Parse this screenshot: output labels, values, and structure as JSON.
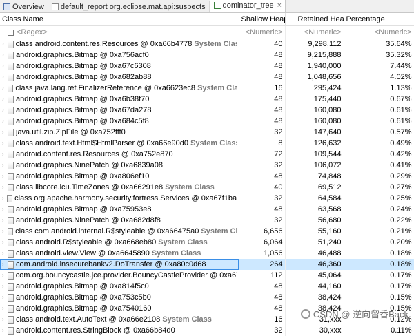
{
  "tabs": [
    {
      "label": "Overview",
      "icon": "overview-icon"
    },
    {
      "label": "default_report  org.eclipse.mat.api:suspects",
      "icon": "report-icon"
    },
    {
      "label": "dominator_tree",
      "icon": "tree-icon",
      "close": "×"
    }
  ],
  "columns": {
    "name": "Class Name",
    "shallow": "Shallow Heap",
    "retained": "Retained Heap",
    "percentage": "Percentage"
  },
  "filter": {
    "name": "<Regex>",
    "shallow": "<Numeric>",
    "retained": "<Numeric>",
    "percentage": "<Numeric>"
  },
  "rows": [
    {
      "name": "class android.content.res.Resources @ 0xa66b4778",
      "suffix": " System Class",
      "shallow": "40",
      "retained": "9,298,112",
      "percentage": "35.64%"
    },
    {
      "name": "android.graphics.Bitmap @ 0xa756acf0",
      "suffix": "",
      "shallow": "48",
      "retained": "9,215,888",
      "percentage": "35.32%"
    },
    {
      "name": "android.graphics.Bitmap @ 0xa67c6308",
      "suffix": "",
      "shallow": "48",
      "retained": "1,940,000",
      "percentage": "7.44%"
    },
    {
      "name": "android.graphics.Bitmap @ 0xa682ab88",
      "suffix": "",
      "shallow": "48",
      "retained": "1,048,656",
      "percentage": "4.02%"
    },
    {
      "name": "class java.lang.ref.FinalizerReference @ 0xa6623ec8",
      "suffix": " System Class",
      "shallow": "16",
      "retained": "295,424",
      "percentage": "1.13%"
    },
    {
      "name": "android.graphics.Bitmap @ 0xa6b38f70",
      "suffix": "",
      "shallow": "48",
      "retained": "175,440",
      "percentage": "0.67%"
    },
    {
      "name": "android.graphics.Bitmap @ 0xa67da278",
      "suffix": "",
      "shallow": "48",
      "retained": "160,080",
      "percentage": "0.61%"
    },
    {
      "name": "android.graphics.Bitmap @ 0xa684c5f8",
      "suffix": "",
      "shallow": "48",
      "retained": "160,080",
      "percentage": "0.61%"
    },
    {
      "name": "java.util.zip.ZipFile @ 0xa752fff0",
      "suffix": "",
      "shallow": "32",
      "retained": "147,640",
      "percentage": "0.57%"
    },
    {
      "name": "class android.text.Html$HtmlParser @ 0xa66e90d0",
      "suffix": " System Class",
      "shallow": "8",
      "retained": "126,632",
      "percentage": "0.49%"
    },
    {
      "name": "android.content.res.Resources @ 0xa752e870",
      "suffix": "",
      "shallow": "72",
      "retained": "109,544",
      "percentage": "0.42%"
    },
    {
      "name": "android.graphics.NinePatch @ 0xa6839a08",
      "suffix": "",
      "shallow": "32",
      "retained": "106,072",
      "percentage": "0.41%"
    },
    {
      "name": "android.graphics.Bitmap @ 0xa806ef10",
      "suffix": "",
      "shallow": "48",
      "retained": "74,848",
      "percentage": "0.29%"
    },
    {
      "name": "class libcore.icu.TimeZones @ 0xa66291e8",
      "suffix": " System Class",
      "shallow": "40",
      "retained": "69,512",
      "percentage": "0.27%"
    },
    {
      "name": "class org.apache.harmony.security.fortress.Services @ 0xa67f1ba8",
      "suffix": " System",
      "shallow": "32",
      "retained": "64,584",
      "percentage": "0.25%"
    },
    {
      "name": "android.graphics.Bitmap @ 0xa75953e8",
      "suffix": "",
      "shallow": "48",
      "retained": "63,568",
      "percentage": "0.24%"
    },
    {
      "name": "android.graphics.NinePatch @ 0xa682d8f8",
      "suffix": "",
      "shallow": "32",
      "retained": "56,680",
      "percentage": "0.22%"
    },
    {
      "name": "class com.android.internal.R$styleable @ 0xa66475a0",
      "suffix": " System Class",
      "shallow": "6,656",
      "retained": "55,160",
      "percentage": "0.21%"
    },
    {
      "name": "class android.R$styleable @ 0xa668eb80",
      "suffix": " System Class",
      "shallow": "6,064",
      "retained": "51,240",
      "percentage": "0.20%"
    },
    {
      "name": "class android.view.View @ 0xa6645890",
      "suffix": " System Class",
      "shallow": "1,056",
      "retained": "46,488",
      "percentage": "0.18%"
    },
    {
      "name": "com.android.insecurebankv2.DoTransfer @ 0xa80c0d68",
      "suffix": "",
      "shallow": "264",
      "retained": "46,360",
      "percentage": "0.18%",
      "selected": true
    },
    {
      "name": "com.org.bouncycastle.jce.provider.BouncyCastleProvider @ 0xa67",
      "suffix": "",
      "shallow": "112",
      "retained": "45,064",
      "percentage": "0.17%"
    },
    {
      "name": "android.graphics.Bitmap @ 0xa814f5c0",
      "suffix": "",
      "shallow": "48",
      "retained": "44,160",
      "percentage": "0.17%"
    },
    {
      "name": "android.graphics.Bitmap @ 0xa753c5b0",
      "suffix": "",
      "shallow": "48",
      "retained": "38,424",
      "percentage": "0.15%"
    },
    {
      "name": "android.graphics.Bitmap @ 0xa7540160",
      "suffix": "",
      "shallow": "48",
      "retained": "38,424",
      "percentage": "0.15%"
    },
    {
      "name": "class android.text.AutoText @ 0xa66e2108",
      "suffix": " System Class",
      "shallow": "16",
      "retained": "31,xxx",
      "percentage": "0.12%"
    },
    {
      "name": "android.content.res.StringBlock @ 0xa66b84d0",
      "suffix": "",
      "shallow": "32",
      "retained": "30,xxx",
      "percentage": "0.11%"
    }
  ],
  "watermark": "CSDN @ 逆向留香Back"
}
